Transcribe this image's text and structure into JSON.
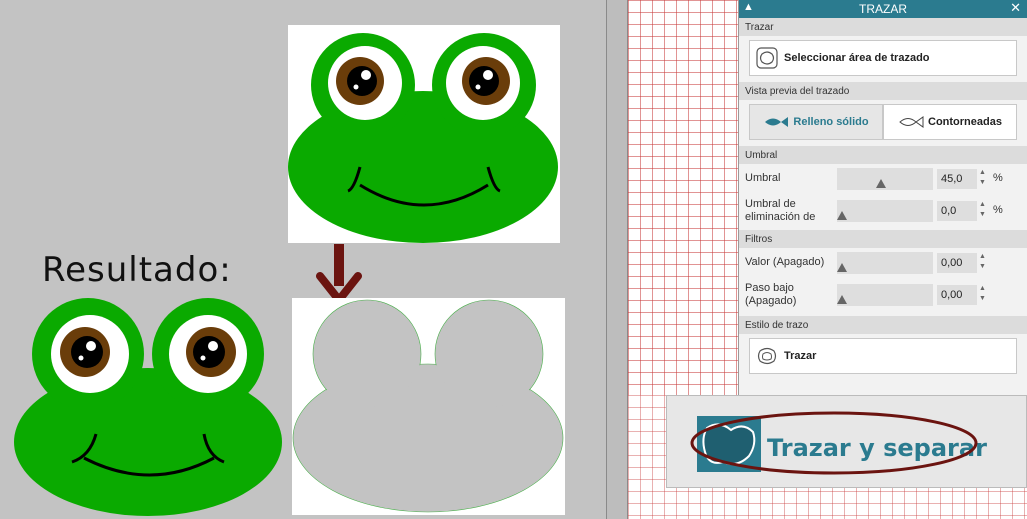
{
  "result_label": "Resultado:",
  "panel": {
    "title": "TRAZAR",
    "collapse_icon": "chevron-up-icon",
    "close_icon": "close-icon",
    "trace_section": {
      "header": "Trazar",
      "select_area_label": "Seleccionar área de trazado"
    },
    "preview_section": {
      "header": "Vista previa del trazado",
      "solid_fill_label": "Relleno sólido",
      "outlines_label": "Contorneadas",
      "active": "solid_fill"
    },
    "threshold_section": {
      "header": "Umbral",
      "threshold": {
        "label": "Umbral",
        "value": "45,0",
        "unit": "%",
        "level": 0.45
      },
      "elimination": {
        "label": "Umbral de eliminación de",
        "value": "0,0",
        "unit": "%",
        "level": 0.0
      }
    },
    "filters_section": {
      "header": "Filtros",
      "value": {
        "label": "Valor (Apagado)",
        "value": "0,00",
        "level": 0.0
      },
      "lowpass": {
        "label": "Paso bajo (Apagado)",
        "value": "0,00",
        "level": 0.0
      }
    },
    "style_section": {
      "header": "Estilo de trazo",
      "trace_label": "Trazar"
    }
  },
  "zoom_callout": {
    "label": "Trazar y separar",
    "highlight_color": "#6b1410"
  },
  "colors": {
    "panel_accent": "#2b7b8f",
    "frog_green": "#0aaa00",
    "arrow": "#6b1410"
  }
}
